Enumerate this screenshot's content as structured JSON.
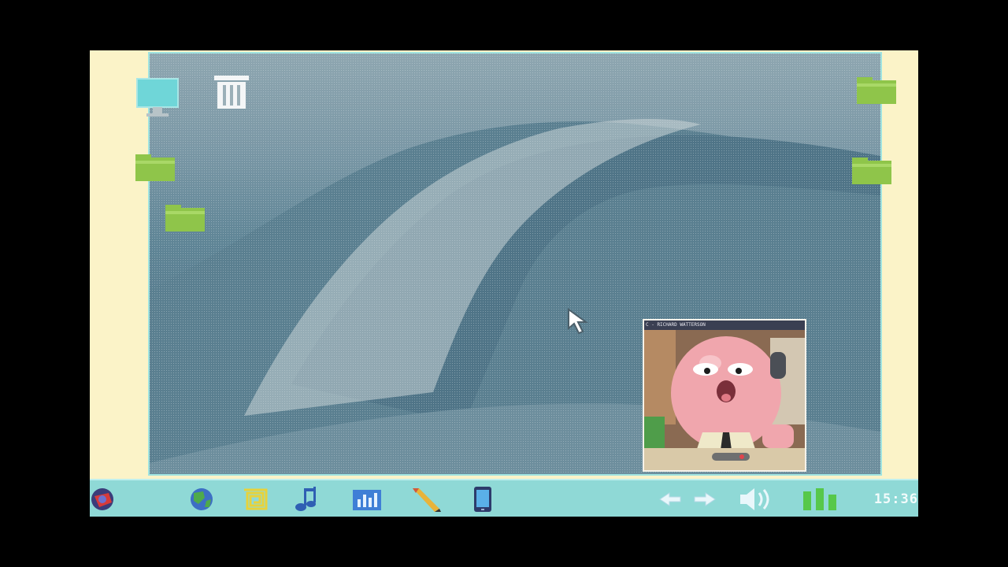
{
  "video_call": {
    "caller": "Richard Watterson",
    "title": "C - RICHARD WATTERSON"
  },
  "taskbar": {
    "clock": "15:36",
    "apps": [
      {
        "name": "start-menu",
        "icon": "start-orb-icon"
      },
      {
        "name": "browser",
        "icon": "globe-icon"
      },
      {
        "name": "spiral-app",
        "icon": "spiral-icon"
      },
      {
        "name": "music",
        "icon": "music-note-icon"
      },
      {
        "name": "charts",
        "icon": "bar-chart-icon"
      },
      {
        "name": "paint",
        "icon": "pencil-icon"
      },
      {
        "name": "phone",
        "icon": "phone-icon"
      }
    ],
    "tray": [
      "back-arrow-icon",
      "forward-arrow-icon",
      "speaker-icon",
      "battery-icon"
    ]
  },
  "desktop": {
    "icons": [
      "computer-icon",
      "trash-icon",
      "folder-icon",
      "folder-icon",
      "folder-icon",
      "folder-icon"
    ]
  },
  "colors": {
    "taskbar": "#8fd9d6",
    "bezel": "#fbf3c8",
    "folder": "#8fc54a",
    "wave": "#5f8596"
  }
}
